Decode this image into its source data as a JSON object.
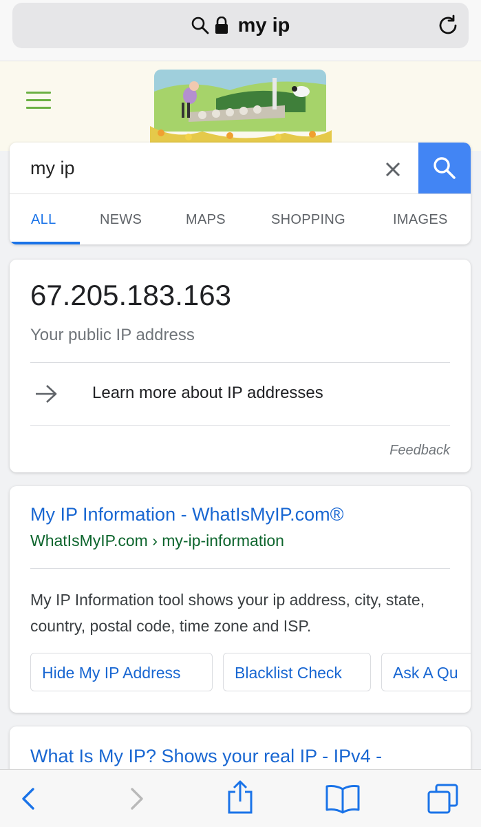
{
  "browser": {
    "url_text": "my ip"
  },
  "search": {
    "query": "my ip",
    "tabs": [
      {
        "label": "ALL",
        "active": true
      },
      {
        "label": "NEWS",
        "active": false
      },
      {
        "label": "MAPS",
        "active": false
      },
      {
        "label": "SHOPPING",
        "active": false
      },
      {
        "label": "IMAGES",
        "active": false
      }
    ]
  },
  "ip_card": {
    "ip": "67.205.183.163",
    "caption": "Your public IP address",
    "learn_more": "Learn more about IP addresses",
    "feedback": "Feedback"
  },
  "results": [
    {
      "title": "My IP Information - WhatIsMyIP.com®",
      "url": "WhatIsMyIP.com › my-ip-information",
      "snippet": "My IP Information tool shows your ip address, city, state, country, postal code, time zone and ISP.",
      "chips": [
        "Hide My IP Address",
        "Blacklist Check",
        "Ask A Qu"
      ]
    },
    {
      "title": "What Is My IP? Shows your real IP - IPv4 -"
    }
  ],
  "colors": {
    "accent_blue": "#1a73e8",
    "search_button": "#4285f4",
    "link_blue": "#1967d2",
    "url_green": "#0d652d",
    "hamburger_green": "#6bb043"
  },
  "icons": {
    "search": "search-icon",
    "lock": "lock-icon",
    "reload": "reload-icon",
    "menu": "hamburger-menu-icon",
    "clear": "close-icon",
    "arrow": "arrow-right-icon",
    "back": "chevron-left-icon",
    "forward": "chevron-right-icon",
    "share": "share-icon",
    "bookmarks": "book-icon",
    "tabs": "tabs-icon"
  }
}
